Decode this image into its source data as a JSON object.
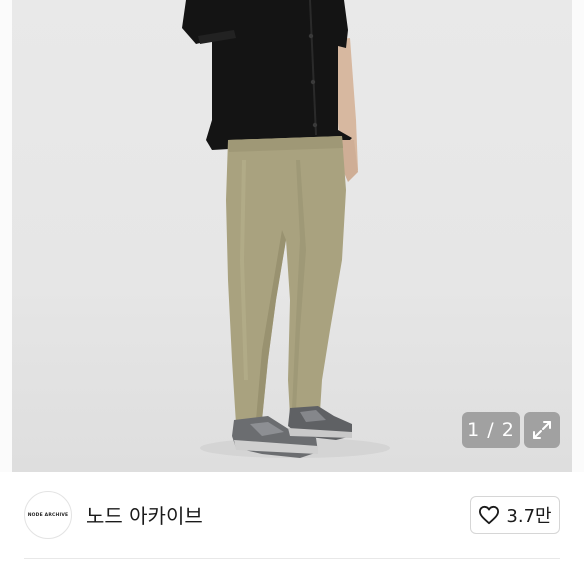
{
  "product": {
    "image_alt": "beige wide pants worn with black short-sleeve shirt and grey sneakers",
    "pager": {
      "current": "1",
      "separator": " / ",
      "total": "2"
    },
    "expand_icon": "expand-icon"
  },
  "seller": {
    "avatar_logo_text": "NODE ARCHIVE",
    "name": "노드 아카이브",
    "like_icon": "heart-icon",
    "like_count": "3.7만"
  },
  "colors": {
    "background": "#ffffff",
    "hero_bg": "#e7e7e7",
    "pants": "#a9a27f",
    "shirt": "#141414",
    "text": "#1a1a1a",
    "border": "#d6d6d6"
  }
}
